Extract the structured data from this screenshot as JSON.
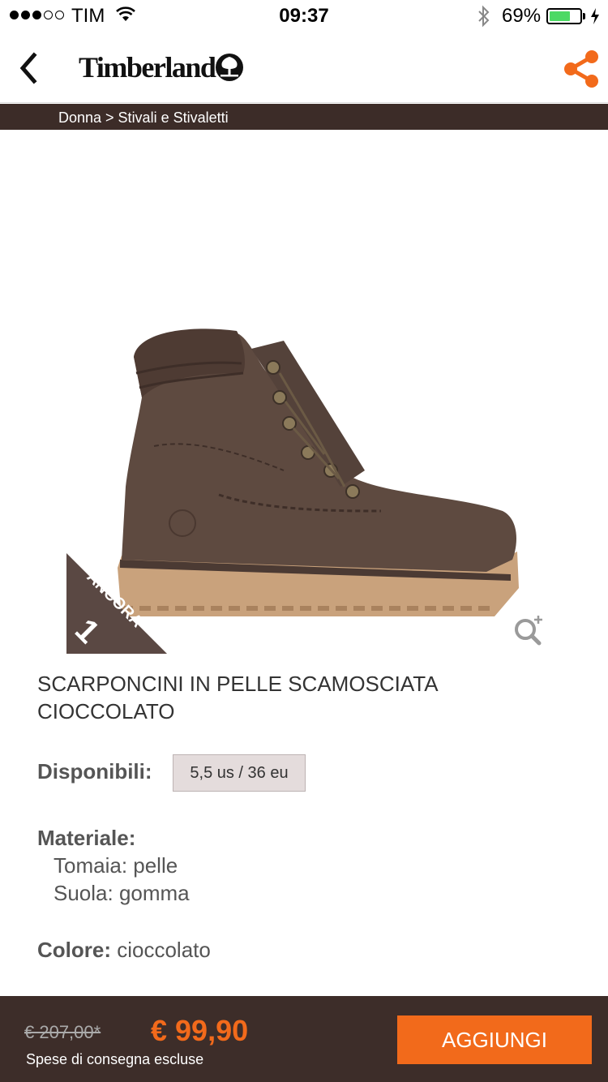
{
  "status_bar": {
    "carrier": "TIM",
    "time": "09:37",
    "battery_percent": "69%",
    "battery_level": 0.69,
    "signal_bars": 3
  },
  "nav": {
    "brand": "Timberland",
    "back_icon": "chevron-left-icon",
    "share_icon": "share-icon",
    "accent_color": "#f26a1b"
  },
  "breadcrumb": "Donna > Stivali e Stivaletti",
  "product": {
    "badge_text": "ANCORA",
    "badge_count": "1",
    "title": "SCARPONCINI IN PELLE SCAMOSCIATA CIOCCOLATO",
    "available_label": "Disponibili:",
    "size": "5,5 us / 36 eu",
    "material_label": "Materiale:",
    "material_upper": "Tomaia: pelle",
    "material_sole": "Suola: gomma",
    "color_label": "Colore:",
    "color_value": "cioccolato"
  },
  "footer": {
    "old_price": "€ 207,00*",
    "price": "€ 99,90",
    "shipping_note": "Spese di consegna escluse",
    "add_label": "AGGIUNGI"
  }
}
